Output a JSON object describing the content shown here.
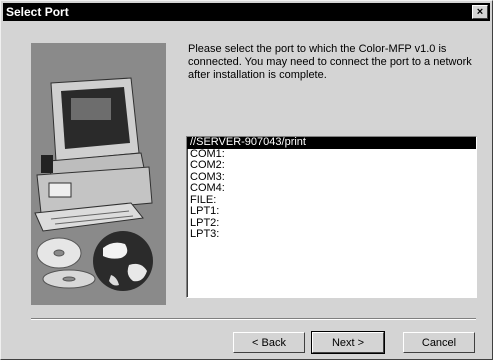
{
  "window": {
    "title": "Select Port",
    "close_label": "x"
  },
  "instruction": "Please select the port to which the Color-MFP v1.0 is connected. You may need to connect the port to a network after installation is complete.",
  "ports": [
    "//SERVER-907043/print",
    "COM1:",
    "COM2:",
    "COM3:",
    "COM4:",
    "FILE:",
    "LPT1:",
    "LPT2:",
    "LPT3:"
  ],
  "selected_port_index": 0,
  "buttons": {
    "back": "< Back",
    "next": "Next >",
    "cancel": "Cancel"
  },
  "illustration_icons": [
    "computer-monitor-icon",
    "cd-disc-icon",
    "globe-icon"
  ]
}
